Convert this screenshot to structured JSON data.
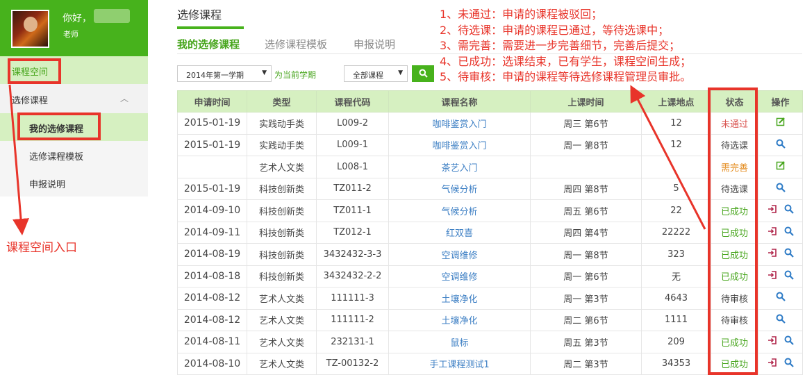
{
  "sidebar": {
    "greeting": "你好，",
    "role": "老师",
    "course_space": "课程空间",
    "group_label": "选修课程",
    "group_chevron": "︿",
    "items": [
      {
        "label": "我的选修课程"
      },
      {
        "label": "选修课程模板"
      },
      {
        "label": "申报说明"
      }
    ]
  },
  "annotation_entry": "课程空间入口",
  "main": {
    "title": "选修课程",
    "tabs": [
      {
        "label": "我的选修课程"
      },
      {
        "label": "选修课程模板"
      },
      {
        "label": "申报说明"
      }
    ],
    "semester_select": "2014年第一学期",
    "current_link": "为当前学期",
    "course_select": "全部课程",
    "search_icon": "search-icon"
  },
  "annotations": [
    "1、未通过：申请的课程被驳回；",
    "2、待选课：申请的课程已通过，等待选课中；",
    "3、需完善：需要进一步完善细节，完善后提交；",
    "4、已成功：选课结束，已有学生，课程空间生成；",
    "5、待审核：申请的课程等待选修课程管理员审批。"
  ],
  "table": {
    "headers": [
      "申请时间",
      "类型",
      "课程代码",
      "课程名称",
      "上课时间",
      "上课地点",
      "状态",
      "操作"
    ],
    "rows": [
      {
        "date": "2015-01-19",
        "type": "实践动手类",
        "code": "L009-2",
        "name": "咖啡鉴赏入门",
        "time": "周三 第6节",
        "place": "12",
        "status": "未通过",
        "status_class": "st-fail",
        "ops": [
          "edit"
        ]
      },
      {
        "date": "2015-01-19",
        "type": "实践动手类",
        "code": "L009-1",
        "name": "咖啡鉴赏入门",
        "time": "周一 第8节",
        "place": "12",
        "status": "待选课",
        "status_class": "st-wait",
        "ops": [
          "search"
        ]
      },
      {
        "date": "",
        "type": "艺术人文类",
        "code": "L008-1",
        "name": "茶艺入门",
        "time": "",
        "place": "",
        "status": "需完善",
        "status_class": "st-improve",
        "ops": [
          "edit"
        ]
      },
      {
        "date": "2015-01-19",
        "type": "科技创新类",
        "code": "TZ011-2",
        "name": "气候分析",
        "time": "周四 第8节",
        "place": "5",
        "status": "待选课",
        "status_class": "st-wait",
        "ops": [
          "search"
        ]
      },
      {
        "date": "2014-09-10",
        "type": "科技创新类",
        "code": "TZ011-1",
        "name": "气候分析",
        "time": "周五 第6节",
        "place": "22",
        "status": "已成功",
        "status_class": "st-ok",
        "ops": [
          "enter",
          "search"
        ]
      },
      {
        "date": "2014-09-11",
        "type": "科技创新类",
        "code": "TZ012-1",
        "name": "红双喜",
        "time": "周四 第4节",
        "place": "22222",
        "status": "已成功",
        "status_class": "st-ok",
        "ops": [
          "enter",
          "search"
        ]
      },
      {
        "date": "2014-08-19",
        "type": "科技创新类",
        "code": "3432432-3-3",
        "name": "空调维修",
        "time": "周一 第8节",
        "place": "323",
        "status": "已成功",
        "status_class": "st-ok",
        "ops": [
          "enter",
          "search"
        ]
      },
      {
        "date": "2014-08-18",
        "type": "科技创新类",
        "code": "3432432-2-2",
        "name": "空调维修",
        "time": "周一 第6节",
        "place": "无",
        "status": "已成功",
        "status_class": "st-ok",
        "ops": [
          "enter",
          "search"
        ]
      },
      {
        "date": "2014-08-12",
        "type": "艺术人文类",
        "code": "111111-3",
        "name": "土壤净化",
        "time": "周一 第3节",
        "place": "4643",
        "status": "待审核",
        "status_class": "st-wait",
        "ops": [
          "search"
        ]
      },
      {
        "date": "2014-08-12",
        "type": "艺术人文类",
        "code": "111111-2",
        "name": "土壤净化",
        "time": "周二 第6节",
        "place": "1111",
        "status": "待审核",
        "status_class": "st-wait",
        "ops": [
          "search"
        ]
      },
      {
        "date": "2014-08-11",
        "type": "艺术人文类",
        "code": "232131-1",
        "name": "鼠标",
        "time": "周五 第3节",
        "place": "209",
        "status": "已成功",
        "status_class": "st-ok",
        "ops": [
          "enter",
          "search"
        ]
      },
      {
        "date": "2014-08-10",
        "type": "艺术人文类",
        "code": "TZ-00132-2",
        "name": "手工课程测试1",
        "time": "周二 第3节",
        "place": "34353",
        "status": "已成功",
        "status_class": "st-ok",
        "ops": [
          "enter",
          "search"
        ]
      }
    ]
  },
  "colors": {
    "brand": "#47b21c",
    "header_bg": "#d6f0c1",
    "annotation": "#e8342a",
    "link": "#3d7fc4"
  }
}
